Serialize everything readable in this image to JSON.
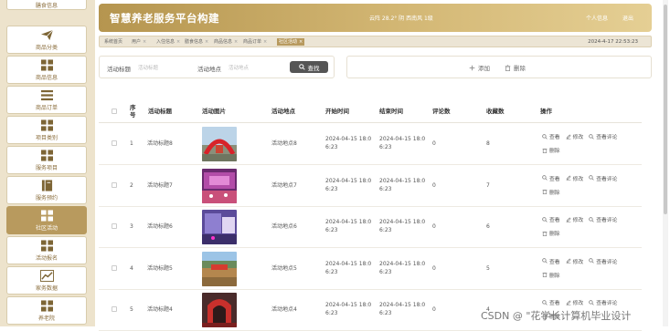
{
  "sidebar": {
    "top_partial": "膳食信息",
    "items": [
      {
        "label": "商品分类",
        "icon": "send-icon"
      },
      {
        "label": "商品信息",
        "icon": "grid-icon"
      },
      {
        "label": "商品订单",
        "icon": "list-icon"
      },
      {
        "label": "项目类别",
        "icon": "grid-icon"
      },
      {
        "label": "服务项目",
        "icon": "grid-icon"
      },
      {
        "label": "服务预约",
        "icon": "book-icon"
      },
      {
        "label": "社区活动",
        "icon": "grid-icon",
        "active": true
      },
      {
        "label": "活动报名",
        "icon": "grid-icon"
      },
      {
        "label": "家务数据",
        "icon": "chart-icon"
      },
      {
        "label": "养老院",
        "icon": "grid-icon"
      }
    ]
  },
  "header": {
    "title": "智慧养老服务平台构建",
    "weather": "云阵 28.2° 阴 西南风 1级",
    "personal_info": "个人信息",
    "logout": "退出"
  },
  "tabs": [
    {
      "label": "系统首页",
      "closable": false
    },
    {
      "label": "用户",
      "closable": true
    },
    {
      "label": "入住信息",
      "closable": true
    },
    {
      "label": "膳食信息",
      "closable": true
    },
    {
      "label": "商品信息",
      "closable": true
    },
    {
      "label": "商品订单",
      "closable": true
    },
    {
      "label": "社区活动",
      "closable": true,
      "active": true
    }
  ],
  "clock": "2024-4-17 22:53:23",
  "search": {
    "title_label": "活动标题",
    "title_placeholder": "活动标题",
    "place_label": "活动地点",
    "place_placeholder": "活动地点",
    "button": "查找"
  },
  "actions": {
    "add": "添加",
    "delete": "删除"
  },
  "table": {
    "headers": {
      "seq": "序号",
      "title": "活动标题",
      "image": "活动图片",
      "place": "活动地点",
      "start": "开始时间",
      "end": "结束时间",
      "comments": "评论数",
      "favorites": "收藏数",
      "ops": "操作"
    },
    "ops": {
      "view": "查看",
      "edit": "修改",
      "view_comments": "查看评论",
      "delete": "删除"
    },
    "rows": [
      {
        "seq": "1",
        "title": "活动标题8",
        "place": "活动地点8",
        "start": "2024-04-15 18:06:23",
        "end": "2024-04-15 18:06:23",
        "comments": "0",
        "favorites": "8",
        "image": "outdoor-event"
      },
      {
        "seq": "2",
        "title": "活动标题7",
        "place": "活动地点7",
        "start": "2024-04-15 18:06:23",
        "end": "2024-04-15 18:06:23",
        "comments": "0",
        "favorites": "7",
        "image": "stage-event"
      },
      {
        "seq": "3",
        "title": "活动标题6",
        "place": "活动地点6",
        "start": "2024-04-15 18:06:23",
        "end": "2024-04-15 18:06:23",
        "comments": "0",
        "favorites": "6",
        "image": "indoor-event"
      },
      {
        "seq": "4",
        "title": "活动标题5",
        "place": "活动地点5",
        "start": "2024-04-15 18:06:23",
        "end": "2024-04-15 18:06:23",
        "comments": "0",
        "favorites": "5",
        "image": "outdoor-gathering"
      },
      {
        "seq": "5",
        "title": "活动标题4",
        "place": "活动地点4",
        "start": "2024-04-15 18:06:23",
        "end": "2024-04-15 18:06:23",
        "comments": "0",
        "favorites": "4",
        "image": "hall-event"
      }
    ]
  },
  "watermark": "CSDN @ \"花学长计算机毕业设计",
  "colors": {
    "accent": "#b89a5e",
    "sidebar_bg": "#ede3cc",
    "header_start": "#b5954f",
    "header_end": "#e5cf94"
  }
}
